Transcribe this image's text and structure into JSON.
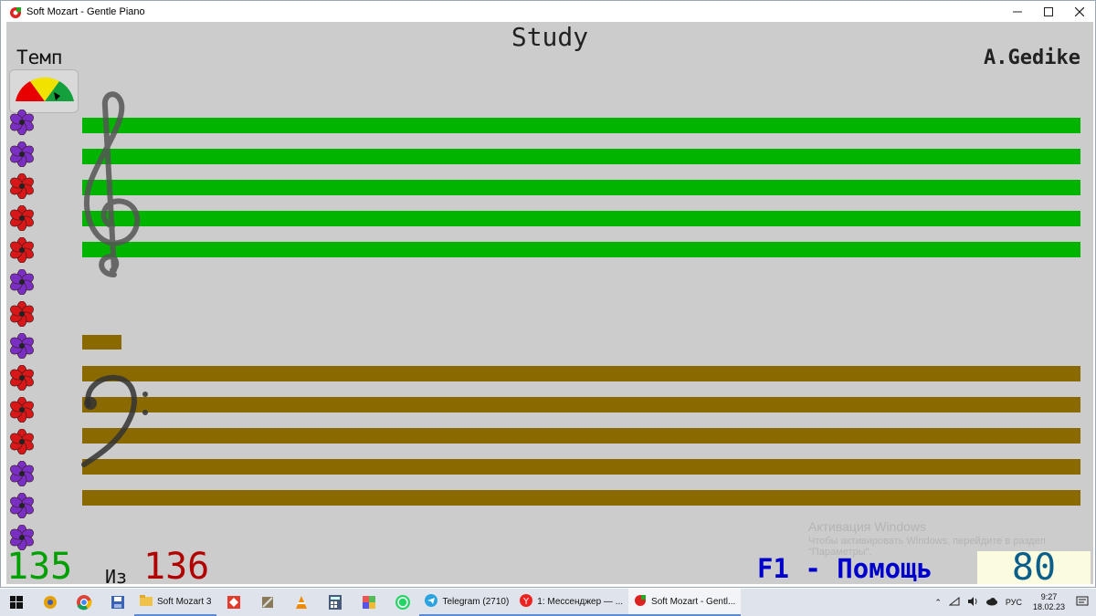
{
  "window": {
    "title": "Soft Mozart - Gentle Piano",
    "controls": [
      "minimize",
      "maximize",
      "close"
    ]
  },
  "score": {
    "title": "Study",
    "composer": "A.Gedike",
    "tempo_label": "Темп",
    "progress_current": "135",
    "progress_of": "Из",
    "progress_total": "136",
    "help_hint": "F1 - Помощь",
    "tempo_value": "80"
  },
  "flowers": [
    "purple",
    "purple",
    "red",
    "red",
    "red",
    "purple",
    "red",
    "purple",
    "red",
    "red",
    "red",
    "purple",
    "purple",
    "purple"
  ],
  "colors": {
    "canvas": "#cccccc",
    "treble_staff": "#00b400",
    "bass_staff": "#8a6a00",
    "flower_red": "#d81818",
    "flower_purple": "#7a2fc4"
  },
  "activation_watermark": {
    "line1": "Активация Windows",
    "line2": "Чтобы активировать Windows, перейдите в раздел",
    "line3": "\"Параметры\"."
  },
  "taskbar": {
    "apps": [
      {
        "icon": "folder-icon",
        "label": "Soft Mozart 3"
      },
      {
        "icon": "telegram-icon",
        "label": "Telegram (2710)"
      },
      {
        "icon": "yandex-icon",
        "label": "1: Мессенджер — ..."
      },
      {
        "icon": "soft-mozart-icon",
        "label": "Soft Mozart - Gentl..."
      }
    ],
    "language": "РУС",
    "time": "9:27",
    "date": "18.02.23"
  }
}
